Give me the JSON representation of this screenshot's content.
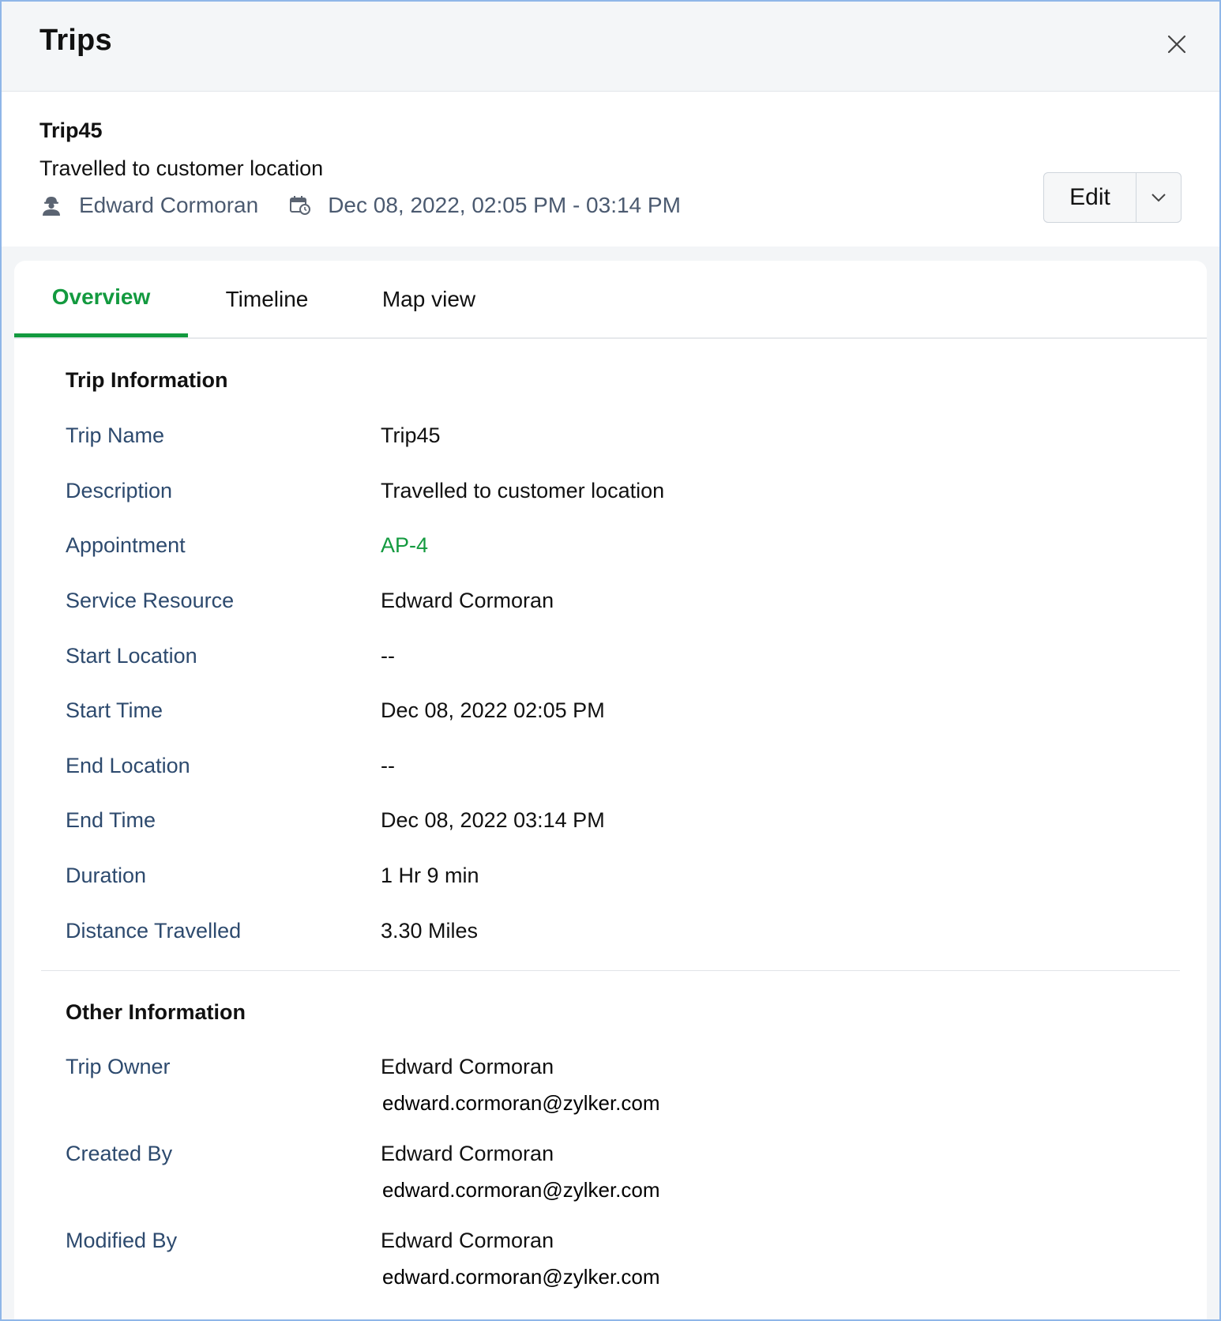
{
  "header": {
    "title": "Trips"
  },
  "summary": {
    "trip_name": "Trip45",
    "description": "Travelled to customer location",
    "resource": "Edward Cormoran",
    "datetime_range": "Dec 08, 2022, 02:05 PM - 03:14 PM",
    "edit_label": "Edit"
  },
  "tabs": [
    {
      "label": "Overview",
      "active": true
    },
    {
      "label": "Timeline",
      "active": false
    },
    {
      "label": "Map view",
      "active": false
    }
  ],
  "trip_information": {
    "title": "Trip Information",
    "fields": [
      {
        "label": "Trip Name",
        "value": "Trip45"
      },
      {
        "label": "Description",
        "value": "Travelled to customer location"
      },
      {
        "label": "Appointment",
        "value": "AP-4"
      },
      {
        "label": "Service Resource",
        "value": "Edward Cormoran"
      },
      {
        "label": "Start Location",
        "value": "--"
      },
      {
        "label": "Start Time",
        "value": "Dec 08, 2022 02:05 PM"
      },
      {
        "label": "End Location",
        "value": "--"
      },
      {
        "label": "End Time",
        "value": "Dec 08, 2022 03:14 PM"
      },
      {
        "label": "Duration",
        "value": "1 Hr 9 min"
      },
      {
        "label": "Distance Travelled",
        "value": "3.30 Miles"
      }
    ]
  },
  "other_information": {
    "title": "Other Information",
    "fields": [
      {
        "label": "Trip Owner",
        "name": "Edward Cormoran",
        "email": "edward.cormoran@zylker.com"
      },
      {
        "label": "Created By",
        "name": "Edward Cormoran",
        "email": "edward.cormoran@zylker.com"
      },
      {
        "label": "Modified By",
        "name": "Edward Cormoran",
        "email": "edward.cormoran@zylker.com"
      }
    ]
  },
  "colors": {
    "accent_green": "#139a3f",
    "label_blue": "#2d4a6e",
    "frame_border": "#8fb6e8"
  },
  "icons": {
    "close": "close-icon",
    "resource": "user-hardhat-icon",
    "calendar": "calendar-clock-icon",
    "dropdown": "chevron-down-icon"
  }
}
